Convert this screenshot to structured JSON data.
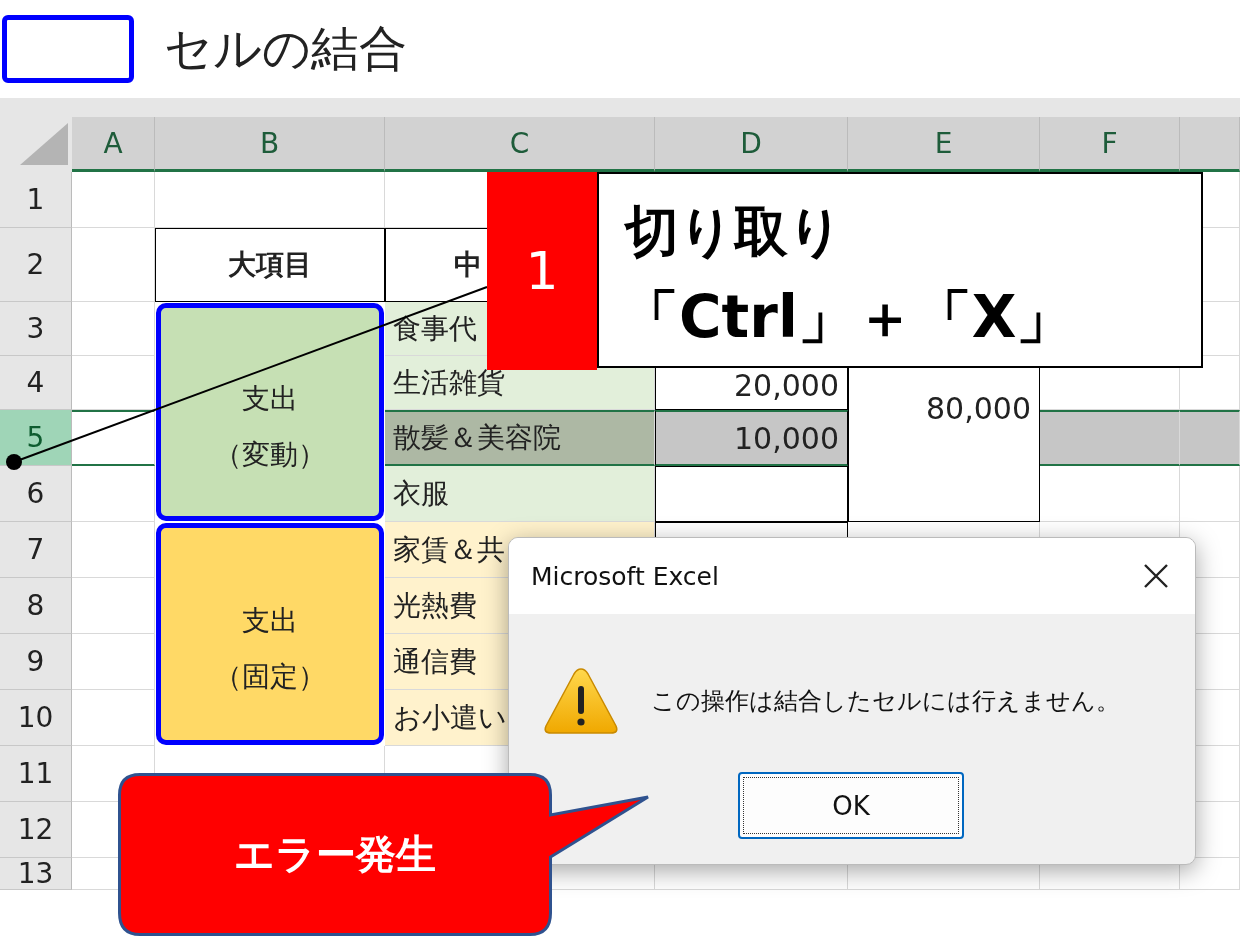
{
  "legend": {
    "label": "セルの結合"
  },
  "sheet": {
    "columns": [
      "A",
      "B",
      "C",
      "D",
      "E",
      "F"
    ],
    "rows": [
      {
        "number": "1",
        "selected": false
      },
      {
        "number": "2",
        "selected": false
      },
      {
        "number": "3",
        "selected": false
      },
      {
        "number": "4",
        "selected": false
      },
      {
        "number": "5",
        "selected": true
      },
      {
        "number": "6",
        "selected": false
      },
      {
        "number": "7",
        "selected": false
      },
      {
        "number": "8",
        "selected": false
      },
      {
        "number": "9",
        "selected": false
      },
      {
        "number": "10",
        "selected": false
      },
      {
        "number": "11",
        "selected": false
      },
      {
        "number": "12",
        "selected": false
      },
      {
        "number": "13",
        "selected": false
      }
    ],
    "headers": [
      "大項目",
      "中"
    ],
    "merged_blocks": [
      {
        "kind": "variable",
        "color": "#c6e0b4",
        "lines": [
          "支出",
          "（変動）"
        ],
        "total": "80,000",
        "items": [
          {
            "name": "食事代"
          },
          {
            "name": "生活雑貨",
            "amount": "20,000"
          },
          {
            "name": "散髪＆美容院",
            "amount": "10,000"
          },
          {
            "name": "衣服"
          }
        ]
      },
      {
        "kind": "fixed",
        "color": "#ffd966",
        "lines": [
          "支出",
          "（固定）"
        ],
        "items": [
          {
            "name": "家賃＆共"
          },
          {
            "name": "光熱費"
          },
          {
            "name": "通信費"
          },
          {
            "name": "お小遣い"
          }
        ]
      }
    ]
  },
  "step_callout": {
    "number": "1",
    "lines": [
      "切り取り",
      "「Ctrl」＋「X」"
    ]
  },
  "dialog": {
    "title": "Microsoft Excel",
    "message": "この操作は結合したセルには行えません。",
    "button": "OK"
  },
  "error_bubble": {
    "text": "エラー発生"
  }
}
